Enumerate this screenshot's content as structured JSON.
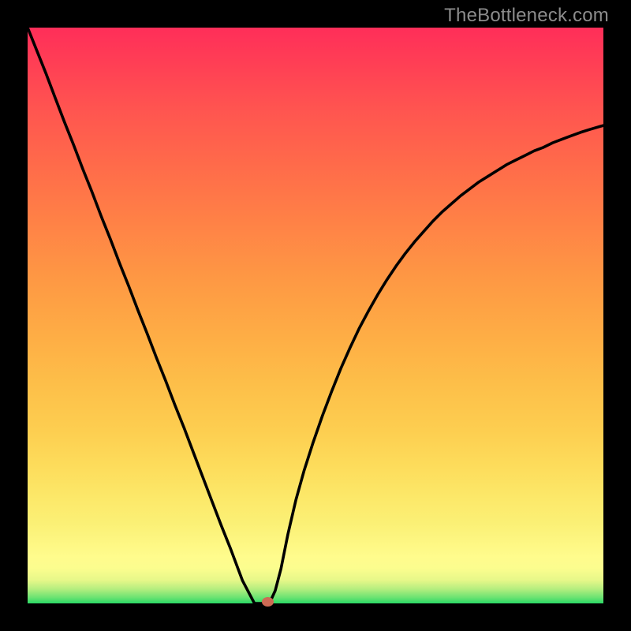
{
  "watermark": "TheBottleneck.com",
  "colors": {
    "frame": "#000000",
    "curve": "#000000",
    "dot": "#cd6a54"
  },
  "chart_data": {
    "type": "line",
    "title": "",
    "xlabel": "",
    "ylabel": "",
    "xlim": [
      0,
      1
    ],
    "ylim": [
      0,
      1
    ],
    "x": [
      0.0,
      0.016,
      0.032,
      0.048,
      0.064,
      0.08,
      0.096,
      0.112,
      0.128,
      0.144,
      0.16,
      0.176,
      0.192,
      0.208,
      0.224,
      0.24,
      0.256,
      0.272,
      0.288,
      0.304,
      0.32,
      0.336,
      0.352,
      0.373,
      0.394,
      0.408,
      0.42,
      0.43,
      0.44,
      0.452,
      0.466,
      0.48,
      0.496,
      0.512,
      0.528,
      0.544,
      0.56,
      0.576,
      0.592,
      0.608,
      0.624,
      0.64,
      0.656,
      0.672,
      0.688,
      0.704,
      0.72,
      0.736,
      0.752,
      0.768,
      0.784,
      0.8,
      0.816,
      0.832,
      0.848,
      0.864,
      0.88,
      0.896,
      0.912,
      0.928,
      0.944,
      0.96,
      0.976,
      1.0
    ],
    "y": [
      1.0,
      0.96,
      0.92,
      0.878,
      0.836,
      0.796,
      0.754,
      0.714,
      0.672,
      0.632,
      0.59,
      0.55,
      0.508,
      0.468,
      0.426,
      0.386,
      0.344,
      0.304,
      0.262,
      0.22,
      0.178,
      0.136,
      0.096,
      0.04,
      0.0,
      0.0,
      0.0,
      0.022,
      0.06,
      0.12,
      0.18,
      0.23,
      0.28,
      0.326,
      0.368,
      0.408,
      0.444,
      0.478,
      0.508,
      0.536,
      0.562,
      0.586,
      0.608,
      0.628,
      0.646,
      0.664,
      0.68,
      0.694,
      0.708,
      0.72,
      0.732,
      0.742,
      0.752,
      0.762,
      0.77,
      0.778,
      0.786,
      0.792,
      0.8,
      0.806,
      0.812,
      0.818,
      0.823,
      0.83
    ],
    "marker": {
      "x": 0.417,
      "y": 0.003
    },
    "annotations": [],
    "legend": false,
    "grid": false
  }
}
